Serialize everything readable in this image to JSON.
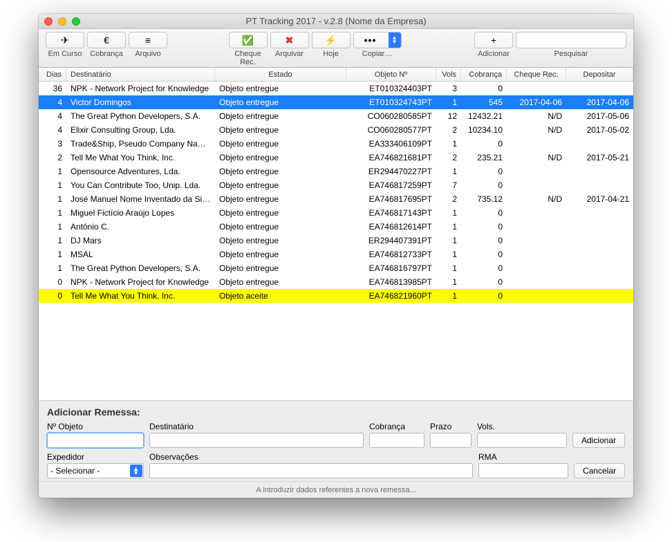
{
  "window": {
    "title": "PT Tracking 2017 - v.2.8 (Nome da Empresa)"
  },
  "toolbar": {
    "em_curso": "Em Curso",
    "cobranca": "Cobrança",
    "arquivo": "Arquivo",
    "cheque_rec": "Cheque Rec.",
    "arquivar": "Arquivar",
    "hoje": "Hoje",
    "copiar": "Copiar…",
    "adicionar": "Adicionar",
    "pesquisar": "Pesquisar",
    "icons": {
      "em_curso": "✈",
      "cobranca": "€",
      "arquivo": "≡",
      "cheque_rec": "✅",
      "arquivar": "✖",
      "hoje": "⚡",
      "copiar": "•••",
      "adicionar": "+"
    }
  },
  "columns": {
    "dias": "Dias",
    "destinatario": "Destinatário",
    "estado": "Estado",
    "objeto": "Objeto Nº",
    "vols": "Vols",
    "cobranca": "Cobrança",
    "cheque_rec": "Cheque Rec.",
    "depositar": "Depositar"
  },
  "rows": [
    {
      "dias": "36",
      "dest": "NPK - Network Project for Knowledge",
      "estado": "Objeto entregue",
      "obj": "ET010324403PT",
      "vols": "3",
      "cob": "0",
      "chq": "",
      "dep": "",
      "sel": false,
      "hl": false
    },
    {
      "dias": "4",
      "dest": "Victor Domingos",
      "estado": "Objeto entregue",
      "obj": "ET010324743PT",
      "vols": "1",
      "cob": "545",
      "chq": "2017-04-06",
      "dep": "2017-04-06",
      "sel": true,
      "hl": false
    },
    {
      "dias": "4",
      "dest": "The Great Python Developers, S.A.",
      "estado": "Objeto entregue",
      "obj": "CO060280585PT",
      "vols": "12",
      "cob": "12432.21",
      "chq": "N/D",
      "dep": "2017-05-06",
      "sel": false,
      "hl": false
    },
    {
      "dias": "4",
      "dest": "Elixir Consulting Group, Lda.",
      "estado": "Objeto entregue",
      "obj": "CO060280577PT",
      "vols": "2",
      "cob": "10234.10",
      "chq": "N/D",
      "dep": "2017-05-02",
      "sel": false,
      "hl": false
    },
    {
      "dias": "3",
      "dest": "Trade&Ship, Pseudo Company Names, I",
      "estado": "Objeto entregue",
      "obj": "EA333406109PT",
      "vols": "1",
      "cob": "0",
      "chq": "",
      "dep": "",
      "sel": false,
      "hl": false
    },
    {
      "dias": "2",
      "dest": "Tell Me What You Think, Inc.",
      "estado": "Objeto entregue",
      "obj": "EA746821681PT",
      "vols": "2",
      "cob": "235.21",
      "chq": "N/D",
      "dep": "2017-05-21",
      "sel": false,
      "hl": false
    },
    {
      "dias": "1",
      "dest": "Opensource Adventures, Lda.",
      "estado": "Objeto entregue",
      "obj": "ER294470227PT",
      "vols": "1",
      "cob": "0",
      "chq": "",
      "dep": "",
      "sel": false,
      "hl": false
    },
    {
      "dias": "1",
      "dest": "You Can Contribute Too, Unip. Lda.",
      "estado": "Objeto entregue",
      "obj": "EA746817259PT",
      "vols": "7",
      "cob": "0",
      "chq": "",
      "dep": "",
      "sel": false,
      "hl": false
    },
    {
      "dias": "1",
      "dest": "José Manuel Nome Inventado da Silva",
      "estado": "Objeto entregue",
      "obj": "EA746817695PT",
      "vols": "2",
      "cob": "735.12",
      "chq": "N/D",
      "dep": "2017-04-21",
      "sel": false,
      "hl": false
    },
    {
      "dias": "1",
      "dest": "Miguel Fictício Araújo Lopes",
      "estado": "Objeto entregue",
      "obj": "EA746817143PT",
      "vols": "1",
      "cob": "0",
      "chq": "",
      "dep": "",
      "sel": false,
      "hl": false
    },
    {
      "dias": "1",
      "dest": "António C.",
      "estado": "Objeto entregue",
      "obj": "EA746812614PT",
      "vols": "1",
      "cob": "0",
      "chq": "",
      "dep": "",
      "sel": false,
      "hl": false
    },
    {
      "dias": "1",
      "dest": "DJ Mars",
      "estado": "Objeto entregue",
      "obj": "ER294407391PT",
      "vols": "1",
      "cob": "0",
      "chq": "",
      "dep": "",
      "sel": false,
      "hl": false
    },
    {
      "dias": "1",
      "dest": "MSAL",
      "estado": "Objeto entregue",
      "obj": "EA746812733PT",
      "vols": "1",
      "cob": "0",
      "chq": "",
      "dep": "",
      "sel": false,
      "hl": false
    },
    {
      "dias": "1",
      "dest": "The Great Python Developers, S.A.",
      "estado": "Objeto entregue",
      "obj": "EA746816797PT",
      "vols": "1",
      "cob": "0",
      "chq": "",
      "dep": "",
      "sel": false,
      "hl": false
    },
    {
      "dias": "0",
      "dest": "NPK - Network Project for Knowledge",
      "estado": "Objeto entregue",
      "obj": "EA746813985PT",
      "vols": "1",
      "cob": "0",
      "chq": "",
      "dep": "",
      "sel": false,
      "hl": false
    },
    {
      "dias": "0",
      "dest": "Tell Me What You Think, Inc.",
      "estado": "Objeto aceite",
      "obj": "EA746821960PT",
      "vols": "1",
      "cob": "0",
      "chq": "",
      "dep": "",
      "sel": false,
      "hl": true
    }
  ],
  "form": {
    "heading": "Adicionar Remessa:",
    "n_objeto": "Nº Objeto",
    "destinatario": "Destinatário",
    "cobranca": "Cobrança",
    "prazo": "Prazo",
    "vols": "Vols.",
    "expedidor": "Expedidor",
    "observacoes": "Observações",
    "rma": "RMA",
    "btn_adicionar": "Adicionar",
    "btn_cancelar": "Cancelar",
    "select_placeholder": "- Selecionar -"
  },
  "status": "A introduzir dados referentes a nova remessa..."
}
